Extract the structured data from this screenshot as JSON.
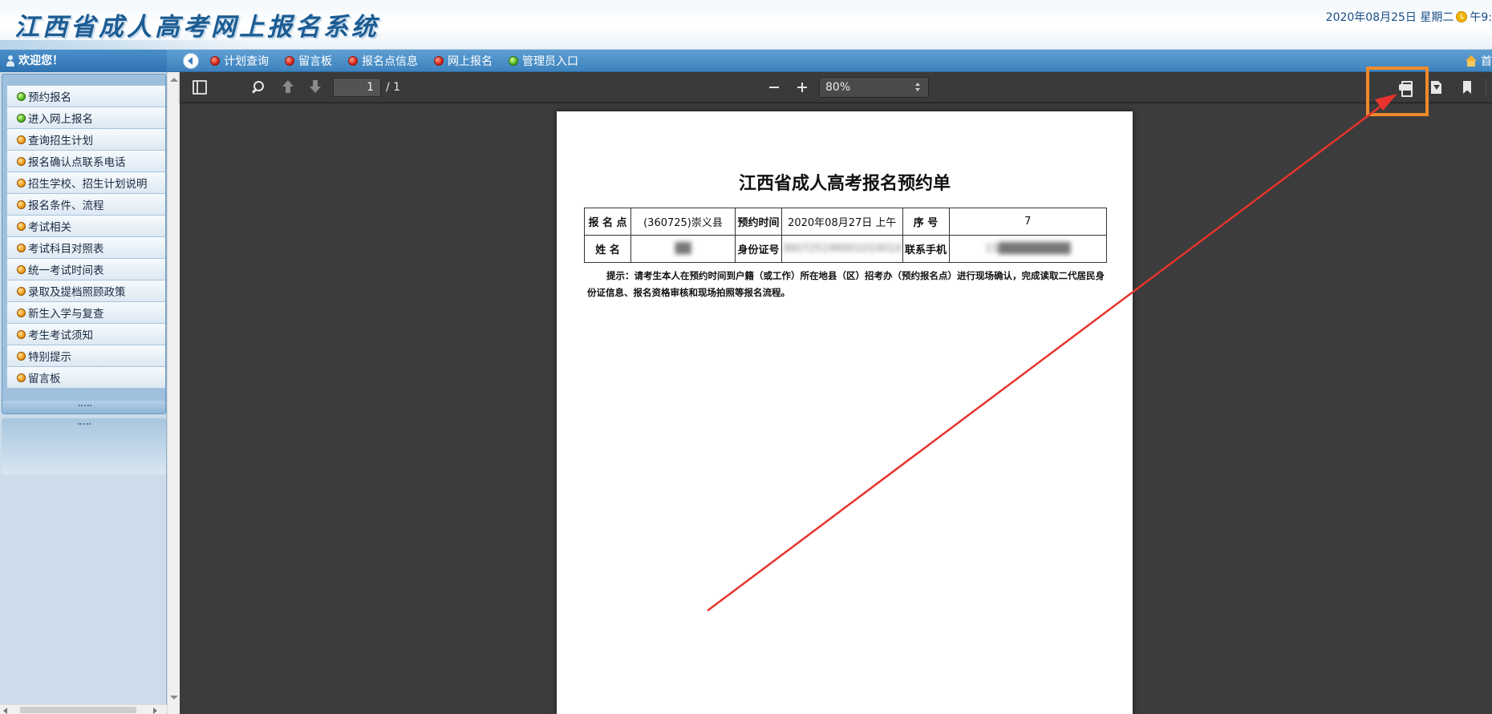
{
  "header": {
    "site_title": "江西省成人高考网上报名系统",
    "date_text": "2020年08月25日 星期二",
    "time_text": "午9:"
  },
  "navbar": {
    "welcome": "欢迎您！",
    "items": [
      {
        "label": "计划查询",
        "color": "red"
      },
      {
        "label": "留言板",
        "color": "red"
      },
      {
        "label": "报名点信息",
        "color": "red"
      },
      {
        "label": "网上报名",
        "color": "red"
      },
      {
        "label": "管理员入口",
        "color": "green"
      }
    ],
    "home_label": "首"
  },
  "sidebar": {
    "items": [
      {
        "label": "预约报名",
        "color": "green"
      },
      {
        "label": "进入网上报名",
        "color": "green"
      },
      {
        "label": "查询招生计划",
        "color": "orange"
      },
      {
        "label": "报名确认点联系电话",
        "color": "orange"
      },
      {
        "label": "招生学校、招生计划说明",
        "color": "orange"
      },
      {
        "label": "报名条件、流程",
        "color": "orange"
      },
      {
        "label": "考试相关",
        "color": "orange"
      },
      {
        "label": "考试科目对照表",
        "color": "orange"
      },
      {
        "label": "统一考试时间表",
        "color": "orange"
      },
      {
        "label": "录取及提档照顾政策",
        "color": "orange"
      },
      {
        "label": "新生入学与复查",
        "color": "orange"
      },
      {
        "label": "考生考试须知",
        "color": "orange"
      },
      {
        "label": "特别提示",
        "color": "orange"
      },
      {
        "label": "留言板",
        "color": "orange"
      }
    ]
  },
  "viewer": {
    "page_number": "1",
    "page_total": "/ 1",
    "zoom": "80%"
  },
  "document": {
    "title": "江西省成人高考报名预约单",
    "row1": {
      "label1": "报 名 点",
      "value1": "(360725)崇义县",
      "label2": "预约时间",
      "value2": "2020年08月27日 上午",
      "label3": "序    号",
      "value3": "7"
    },
    "row2": {
      "label1": "姓    名",
      "value1": "██",
      "label2": "身份证号",
      "value2": "36072519900101001X",
      "label3": "联系手机",
      "value3": "15█████████"
    },
    "tip": "提示：请考生本人在预约时间到户籍（或工作）所在地县（区）招考办（预约报名点）进行现场确认，完成读取二代居民身份证信息、报名资格审核和现场拍照等报名流程。"
  },
  "colors": {
    "header_blue": "#1c5c93",
    "nav_blue": "#3d82bd",
    "viewer_bg": "#3c3c3c",
    "highlight": "#f08a2a",
    "arrow": "#e8332e"
  }
}
